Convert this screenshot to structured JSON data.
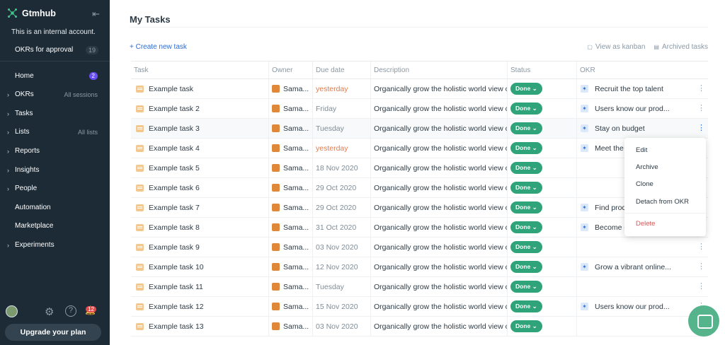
{
  "app": {
    "name": "Gtmhub",
    "account_note": "This is an internal account.",
    "okrs_for_approval": "OKRs for approval",
    "okrs_for_approval_count": "19"
  },
  "sidebar": {
    "items": [
      {
        "label": "Home",
        "badge": "2",
        "extra": ""
      },
      {
        "label": "OKRs",
        "badge": "",
        "extra": "All sessions"
      },
      {
        "label": "Tasks",
        "badge": "",
        "extra": ""
      },
      {
        "label": "Lists",
        "badge": "",
        "extra": "All lists"
      },
      {
        "label": "Reports",
        "badge": "",
        "extra": ""
      },
      {
        "label": "Insights",
        "badge": "",
        "extra": ""
      },
      {
        "label": "People",
        "badge": "",
        "extra": ""
      },
      {
        "label": "Automation",
        "badge": "",
        "extra": ""
      },
      {
        "label": "Marketplace",
        "badge": "",
        "extra": ""
      },
      {
        "label": "Experiments",
        "badge": "",
        "extra": ""
      }
    ],
    "notifications": "12",
    "upgrade": "Upgrade your plan"
  },
  "page": {
    "title": "My Tasks",
    "create_task": "+ Create new task",
    "view_kanban": "View as kanban",
    "archived": "Archived tasks"
  },
  "table": {
    "headers": [
      "Task",
      "Owner",
      "Due date",
      "Description",
      "Status",
      "OKR"
    ],
    "rows": [
      {
        "task": "Example task",
        "owner": "Sama...",
        "due": "yesterday",
        "desc": "Organically grow the holistic world view c",
        "status": "Done",
        "okr": "Recruit the top talent"
      },
      {
        "task": "Example task 2",
        "owner": "Sama...",
        "due": "Friday",
        "desc": "Organically grow the holistic world view c",
        "status": "Done",
        "okr": "Users know our prod..."
      },
      {
        "task": "Example task 3",
        "owner": "Sama...",
        "due": "Tuesday",
        "desc": "Organically grow the holistic world view c",
        "status": "Done",
        "okr": "Stay on budget"
      },
      {
        "task": "Example task 4",
        "owner": "Sama...",
        "due": "yesterday",
        "desc": "Organically grow the holistic world view c",
        "status": "Done",
        "okr": "Meet the c"
      },
      {
        "task": "Example task 5",
        "owner": "Sama...",
        "due": "18 Nov 2020",
        "desc": "Organically grow the holistic world view c",
        "status": "Done",
        "okr": ""
      },
      {
        "task": "Example task 6",
        "owner": "Sama...",
        "due": "29 Oct 2020",
        "desc": "Organically grow the holistic world view c",
        "status": "Done",
        "okr": ""
      },
      {
        "task": "Example task 7",
        "owner": "Sama...",
        "due": "29 Oct 2020",
        "desc": "Organically grow the holistic world view c",
        "status": "Done",
        "okr": "Find produ"
      },
      {
        "task": "Example task 8",
        "owner": "Sama...",
        "due": "31 Oct 2020",
        "desc": "Organically grow the holistic world view c",
        "status": "Done",
        "okr": "Become c"
      },
      {
        "task": "Example task 9",
        "owner": "Sama...",
        "due": "03 Nov 2020",
        "desc": "Organically grow the holistic world view c",
        "status": "Done",
        "okr": ""
      },
      {
        "task": "Example task 10",
        "owner": "Sama...",
        "due": "12 Nov 2020",
        "desc": "Organically grow the holistic world view c",
        "status": "Done",
        "okr": "Grow a vibrant online..."
      },
      {
        "task": "Example task 11",
        "owner": "Sama...",
        "due": "Tuesday",
        "desc": "Organically grow the holistic world view c",
        "status": "Done",
        "okr": ""
      },
      {
        "task": "Example task 12",
        "owner": "Sama...",
        "due": "15 Nov 2020",
        "desc": "Organically grow the holistic world view c",
        "status": "Done",
        "okr": "Users know our prod..."
      },
      {
        "task": "Example task 13",
        "owner": "Sama...",
        "due": "03 Nov 2020",
        "desc": "Organically grow the holistic world view c",
        "status": "Done",
        "okr": ""
      }
    ]
  },
  "context_menu": {
    "edit": "Edit",
    "archive": "Archive",
    "clone": "Clone",
    "detach": "Detach from OKR",
    "delete": "Delete"
  },
  "colors": {
    "sidebar_bg": "#1c2b36",
    "done_green": "#2fa37a",
    "link_blue": "#2a6bd7",
    "overdue": "#e07a4c",
    "delete_red": "#e05252"
  }
}
